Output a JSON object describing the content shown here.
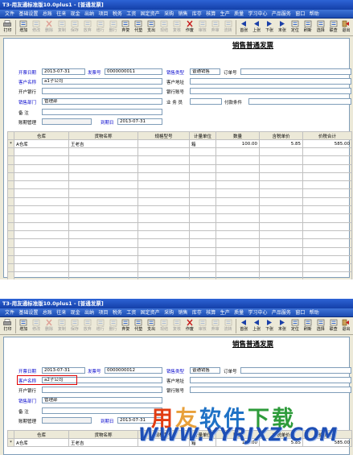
{
  "window": {
    "title": "T3-用友通标准版10.0plus1 - [普通发票]"
  },
  "menu": [
    "文件",
    "基础设置",
    "总账",
    "往来",
    "现金",
    "出纳",
    "项目",
    "税务",
    "工资",
    "固定资产",
    "采购",
    "销售",
    "库存",
    "核算",
    "生产",
    "质量",
    "学习中心",
    "产品服务",
    "窗口",
    "帮助"
  ],
  "toolbar": [
    {
      "label": "打印",
      "icon": "print-icon",
      "enabled": true
    },
    {
      "label": "增加",
      "icon": "add-icon",
      "enabled": true
    },
    {
      "label": "修改",
      "icon": "edit-icon",
      "enabled": false
    },
    {
      "label": "删除",
      "icon": "delete-icon",
      "enabled": false
    },
    {
      "label": "复制",
      "icon": "copy-icon",
      "enabled": false
    },
    {
      "label": "保存",
      "icon": "save-icon",
      "enabled": false
    },
    {
      "label": "放弃",
      "icon": "cancel-icon",
      "enabled": false
    },
    {
      "label": "增行",
      "icon": "add-row-icon",
      "enabled": false
    },
    {
      "label": "删行",
      "icon": "delete-row-icon",
      "enabled": false
    },
    {
      "label": "弃复",
      "icon": "unreview-icon",
      "enabled": true
    },
    {
      "label": "代垫",
      "icon": "advance-icon",
      "enabled": true
    },
    {
      "label": "支出",
      "icon": "expense-icon",
      "enabled": true
    },
    {
      "label": "现结",
      "icon": "cash-settle-icon",
      "enabled": false
    },
    {
      "label": "复核",
      "icon": "review-icon",
      "enabled": false
    },
    {
      "label": "作废",
      "icon": "void-icon",
      "enabled": true
    },
    {
      "label": "审核",
      "icon": "approve-icon",
      "enabled": false
    },
    {
      "label": "弃审",
      "icon": "unapprove-icon",
      "enabled": false
    },
    {
      "label": "流转",
      "icon": "flow-icon",
      "enabled": false
    },
    {
      "label": "首张",
      "icon": "first-icon",
      "enabled": true
    },
    {
      "label": "上张",
      "icon": "prev-icon",
      "enabled": true
    },
    {
      "label": "下张",
      "icon": "next-icon",
      "enabled": true
    },
    {
      "label": "末张",
      "icon": "last-icon",
      "enabled": true
    },
    {
      "label": "定位",
      "icon": "locate-icon",
      "enabled": true
    },
    {
      "label": "刷新",
      "icon": "refresh-icon",
      "enabled": true
    },
    {
      "label": "选择",
      "icon": "select-icon",
      "enabled": true
    },
    {
      "label": "联查",
      "icon": "query-icon",
      "enabled": true
    },
    {
      "label": "退出",
      "icon": "exit-icon",
      "enabled": true
    }
  ],
  "invoice1": {
    "title": "销售普通发票",
    "labels": {
      "date": "开票日期",
      "number": "发票号",
      "sale_type": "销售类型",
      "order_no": "订单号",
      "customer": "客户名称",
      "address": "客户地址",
      "bank": "开户银行",
      "account": "银行账号",
      "dept": "销售部门",
      "salesman": "业 务 员",
      "pay_terms": "付款条件",
      "remark": "备 注",
      "due": "账期管理",
      "due_date": "到期日"
    },
    "values": {
      "date": "2013-07-31",
      "number": "0000000011",
      "sale_type": "普通销售",
      "customer": "a1子公司",
      "dept": "管理部",
      "due_date": "2013-07-31"
    }
  },
  "invoice2": {
    "title": "销售普通发票",
    "labels": {
      "date": "开票日期",
      "number": "发票号",
      "sale_type": "销售类型",
      "order_no": "订单号",
      "customer": "客户名称",
      "address": "客户地址",
      "bank": "开户银行",
      "account": "银行账号",
      "dept": "销售部门",
      "remark": "备 注",
      "due": "账期管理",
      "due_date": "到期日"
    },
    "values": {
      "date": "2013-07-31",
      "number": "0000000012",
      "sale_type": "普通销售",
      "customer": "a2子公司",
      "dept": "管理部",
      "due_date": "2013-07-31"
    }
  },
  "grid": {
    "columns": [
      "仓库",
      "货物名称",
      "规格型号",
      "计量单位",
      "数量",
      "含税单价",
      "价税合计"
    ],
    "row": {
      "mark": "*",
      "warehouse": "A仓库",
      "goods": "王老吉",
      "spec": "",
      "unit": "箱",
      "qty": "100.00",
      "price": "5.85",
      "total": "585.00"
    },
    "row2": {
      "mark": "*",
      "warehouse": "A仓库",
      "goods": "王老吉",
      "spec": "",
      "unit": "箱",
      "qty": "100.00",
      "price": "5.85",
      "total": "585.00"
    }
  },
  "watermark": {
    "line1": "用友软件下载",
    "line2": "WWW.YYRJXZ.COM"
  },
  "colors": {
    "titlebar": "#1440a8",
    "menubar": "#1b4bb0",
    "label_blue": "#0000cc",
    "highlight_red": "#e00000"
  }
}
